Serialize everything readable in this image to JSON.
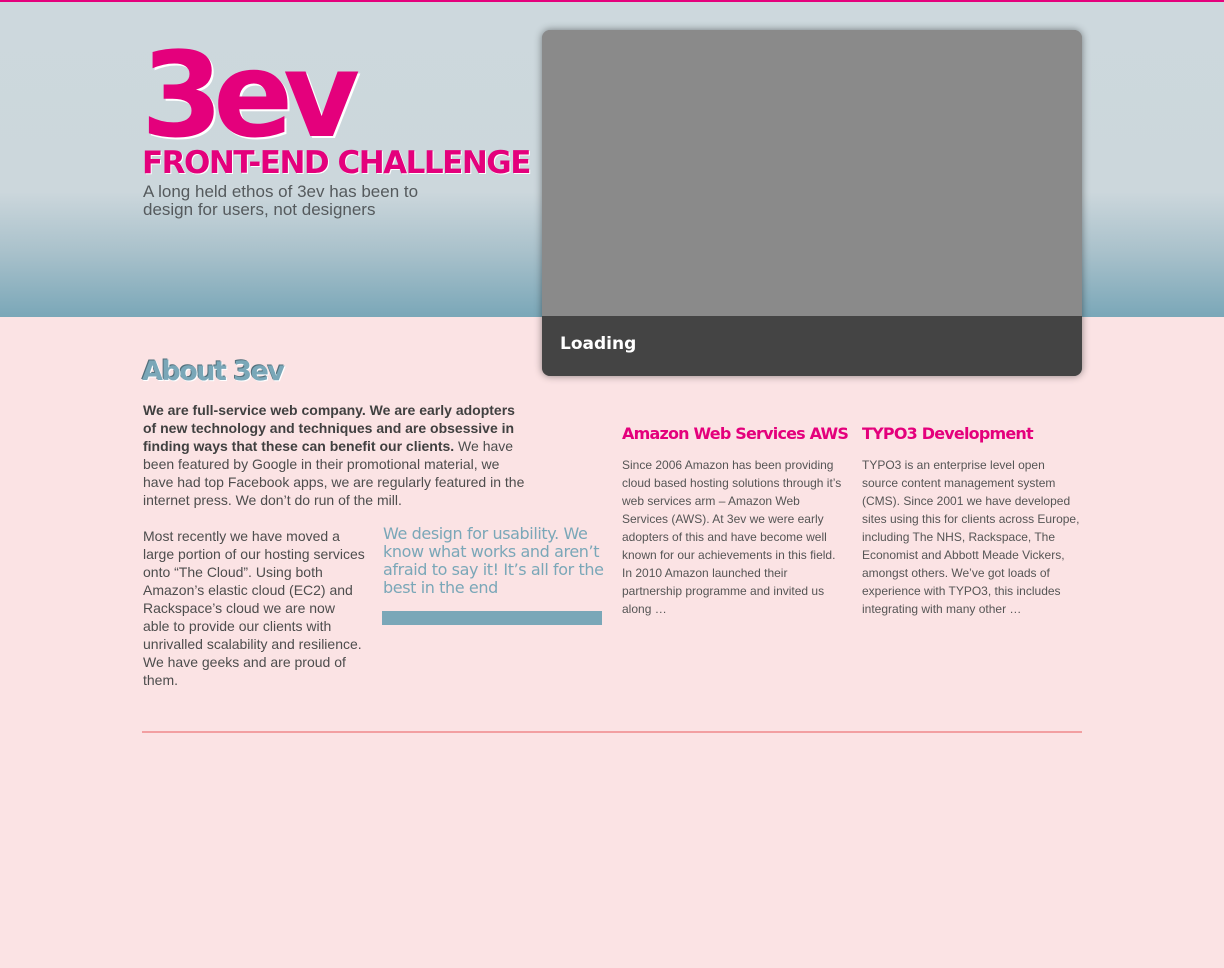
{
  "header": {
    "logo_text": "3ev",
    "title": "FRONT-END CHALLENGE",
    "tagline": "A long held ethos of 3ev has been to design for users, not designers"
  },
  "slideshow": {
    "caption": "Loading"
  },
  "about": {
    "title": "About 3ev",
    "intro_bold": "We are full-service web company. We are early adopters of new technology and techniques and are obsessive in finding ways that these can benefit our clients.",
    "intro_rest": " We have been featured by Google in their promotional material, we have had top Facebook apps, we are regularly featured in the internet press. We don’t do run of the mill.",
    "cloud_text": "Most recently we have moved a large portion of our hosting services onto “The Cloud”. Using both Amazon’s elastic cloud (EC2) and Rackspace’s cloud we are now able to provide our clients with unrivalled scalability and resilience. We have geeks and are proud of them.",
    "quote": "We design for usability. We know what works and aren’t afraid to say it! It’s all for the best in the end"
  },
  "services": [
    {
      "title": "Amazon Web Services AWS",
      "body": "Since 2006 Amazon has been providing cloud based hosting solutions through it’s web services arm – Amazon Web Services (AWS). At 3ev we were early adopters of this and have become well known for our achievements in this field. In 2010 Amazon launched their partnership programme and invited us along …"
    },
    {
      "title": "TYPO3 Development",
      "body": "TYPO3 is an enterprise level open source content management system (CMS). Since 2001 we have developed sites using this for clients across Europe, including The NHS, Rackspace, The Economist and Abbott Meade Vickers, amongst others. We’ve got loads of experience with TYPO3, this includes integrating with many other …"
    }
  ],
  "colors": {
    "brand_pink": "#e4007c",
    "accent_blue": "#7aa7b8",
    "page_background": "#fbe3e4"
  }
}
